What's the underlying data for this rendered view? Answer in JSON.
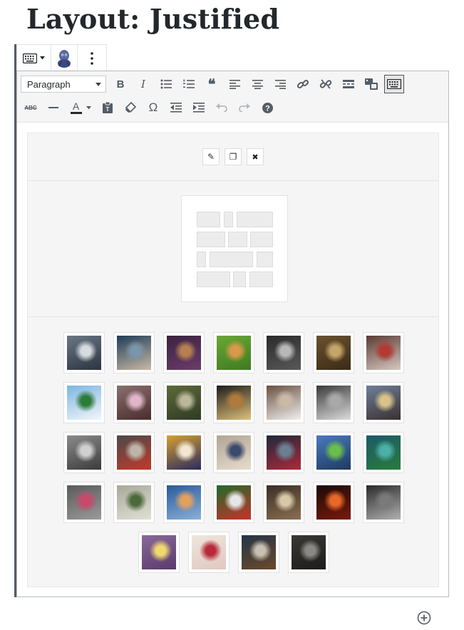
{
  "page": {
    "title": "Layout: Justified"
  },
  "block_toolbar": {
    "items": [
      {
        "name": "keyboard-icon"
      },
      {
        "name": "avatar-icon"
      },
      {
        "name": "more-options-icon"
      }
    ]
  },
  "editor_toolbar": {
    "format_select": {
      "value": "Paragraph"
    },
    "row1": [
      "bold",
      "italic",
      "bullet-list",
      "numbered-list",
      "blockquote",
      "align-left",
      "align-center",
      "align-right",
      "insert-link",
      "remove-link",
      "read-more",
      "gallery-toggle",
      "toolbar-toggle"
    ],
    "row2": [
      "strikethrough",
      "horizontal-line",
      "text-color",
      "paste-as-text",
      "clear-formatting",
      "special-character",
      "decrease-indent",
      "increase-indent",
      "undo",
      "redo",
      "help"
    ],
    "labels": {
      "bold": "B",
      "italic": "I",
      "strikethrough": "ABC",
      "text_color": "A",
      "omega": "Ω",
      "quote": "❝"
    }
  },
  "gallery": {
    "layout": "justified",
    "actions": [
      {
        "name": "edit",
        "glyph": "✎"
      },
      {
        "name": "duplicate",
        "glyph": "❐"
      },
      {
        "name": "remove",
        "glyph": "✖"
      }
    ],
    "thumbnails": [
      {
        "subject": "girl with heart sketch",
        "colors": [
          "#6a7786",
          "#d6dbe0",
          "#2b3440"
        ]
      },
      {
        "subject": "elephant in water",
        "colors": [
          "#1e3c58",
          "#7a96a8",
          "#c9b9a5"
        ]
      },
      {
        "subject": "tower of sweets",
        "colors": [
          "#3a2340",
          "#b88050",
          "#6b3c6a"
        ]
      },
      {
        "subject": "man eating burger",
        "colors": [
          "#6aa838",
          "#d89a48",
          "#3f7a20"
        ]
      },
      {
        "subject": "white horse",
        "colors": [
          "#2a2a2a",
          "#b8b8b8",
          "#595959"
        ]
      },
      {
        "subject": "vintage still life",
        "colors": [
          "#6b5230",
          "#c7a46a",
          "#3a2a16"
        ]
      },
      {
        "subject": "steak heart",
        "colors": [
          "#5a3a34",
          "#b23a32",
          "#d6c8c0"
        ]
      },
      {
        "subject": "tiny planet",
        "colors": [
          "#7bb6e0",
          "#2e7a3a",
          "#f3f6fa"
        ]
      },
      {
        "subject": "girl with donuts",
        "colors": [
          "#8a7070",
          "#e0b6c8",
          "#4a2c2c"
        ]
      },
      {
        "subject": "surreal landscape",
        "colors": [
          "#5e6a3a",
          "#b9b89a",
          "#2f3a24"
        ]
      },
      {
        "subject": "falling food",
        "colors": [
          "#1c1c1c",
          "#b07a3a",
          "#e0c07a"
        ]
      },
      {
        "subject": "cat with laptop",
        "colors": [
          "#6a5040",
          "#c9b9a6",
          "#f0f0f0"
        ]
      },
      {
        "subject": "eiffel tower",
        "colors": [
          "#3a3a3a",
          "#a9a9a9",
          "#dcdcdc"
        ]
      },
      {
        "subject": "road at sunset",
        "colors": [
          "#6f7f9a",
          "#d9c28a",
          "#3a3030"
        ]
      },
      {
        "subject": "cat jumping",
        "colors": [
          "#8b8b8b",
          "#d0d0d0",
          "#3b3b3b"
        ]
      },
      {
        "subject": "man in street",
        "colors": [
          "#4a4a4a",
          "#bdb6a8",
          "#c23a2a"
        ]
      },
      {
        "subject": "bowling pins",
        "colors": [
          "#d4a030",
          "#f2e6d0",
          "#2a2a60"
        ]
      },
      {
        "subject": "man juggling",
        "colors": [
          "#b0a494",
          "#3a4a6a",
          "#e8dccc"
        ]
      },
      {
        "subject": "world map suitcase",
        "colors": [
          "#1c2a3a",
          "#6a8090",
          "#b0283a"
        ]
      },
      {
        "subject": "golfer on green",
        "colors": [
          "#4a7ac0",
          "#6abf4a",
          "#1e3a60"
        ]
      },
      {
        "subject": "turtle island",
        "colors": [
          "#1c5a6a",
          "#4ab0a8",
          "#2a7a3a"
        ]
      },
      {
        "subject": "knitted heart",
        "colors": [
          "#5a5a5a",
          "#c84a6a",
          "#9a9a9a"
        ]
      },
      {
        "subject": "money printer",
        "colors": [
          "#a8a89a",
          "#4a6a3a",
          "#e0e0d4"
        ]
      },
      {
        "subject": "man eating",
        "colors": [
          "#2a5a9a",
          "#e0a060",
          "#8ab0d8"
        ]
      },
      {
        "subject": "billiard balls",
        "colors": [
          "#1f6a2a",
          "#e6e6e6",
          "#c8322a"
        ]
      },
      {
        "subject": "white lion",
        "colors": [
          "#3a2e26",
          "#d8c8a8",
          "#8a7050"
        ]
      },
      {
        "subject": "fire fruit",
        "colors": [
          "#1a0a08",
          "#e8682a",
          "#7a1a0a"
        ]
      },
      {
        "subject": "guitar on wall",
        "colors": [
          "#2a2a2a",
          "#7a7a7a",
          "#b0b0b0"
        ]
      },
      {
        "subject": "laptop and coffee",
        "colors": [
          "#8a6a9a",
          "#f0d870",
          "#5a3a6a"
        ]
      },
      {
        "subject": "red splash dancer",
        "colors": [
          "#efe6dc",
          "#b82a3a",
          "#e0c8c0"
        ]
      },
      {
        "subject": "table with dishes",
        "colors": [
          "#243448",
          "#c8c0b0",
          "#6a4a2a"
        ]
      },
      {
        "subject": "man in suit",
        "colors": [
          "#3a3834",
          "#8a8884",
          "#1e1c1a"
        ]
      }
    ]
  },
  "footer": {
    "add_block_icon": "plus-circle-icon"
  }
}
